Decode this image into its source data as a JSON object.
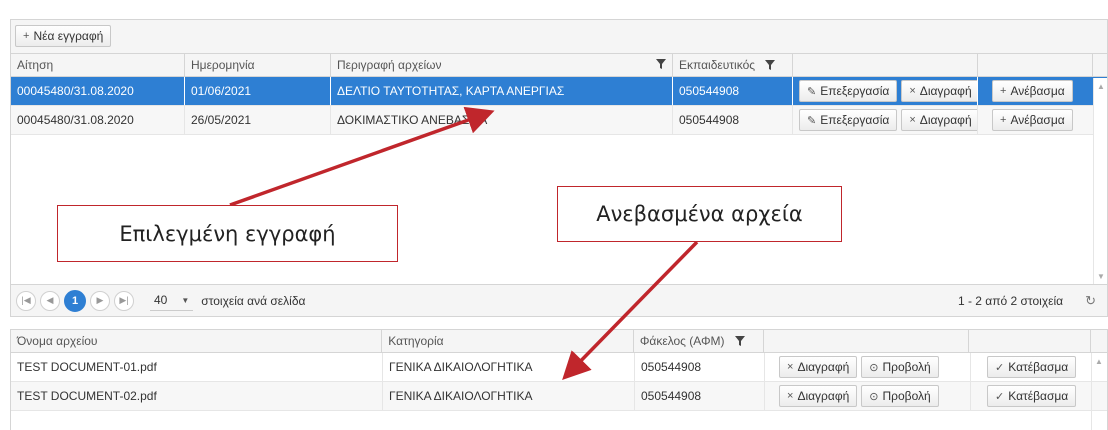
{
  "toolbar": {
    "new_record_label": "Νέα εγγραφή"
  },
  "top_grid": {
    "columns": [
      "Αίτηση",
      "Ημερομηνία",
      "Περιγραφή αρχείων",
      "Εκπαιδευτικός"
    ],
    "rows": [
      {
        "application": "00045480/31.08.2020",
        "date": "01/06/2021",
        "description": "ΔΕΛΤΙΟ ΤΑΥΤΟΤΗΤΑΣ, ΚΑΡΤΑ ΑΝΕΡΓΙΑΣ",
        "teacher": "050544908",
        "selected": true
      },
      {
        "application": "00045480/31.08.2020",
        "date": "26/05/2021",
        "description": "ΔΟΚΙΜΑΣΤΙΚΟ ΑΝΕΒΑΣΜΑ",
        "teacher": "050544908",
        "selected": false
      }
    ],
    "actions": {
      "edit": "Επεξεργασία",
      "delete": "Διαγραφή",
      "upload": "Ανέβασμα"
    }
  },
  "pager": {
    "current_page": "1",
    "page_size": "40",
    "page_size_label": "στοιχεία ανά σελίδα",
    "info": "1 - 2 από 2 στοιχεία"
  },
  "bottom_grid": {
    "columns": [
      "Όνομα αρχείου",
      "Κατηγορία",
      "Φάκελος (ΑΦΜ)"
    ],
    "rows": [
      {
        "file_name": "TEST DOCUMENT-01.pdf",
        "category": "ΓΕΝΙΚΑ ΔΙΚΑΙΟΛΟΓΗΤΙΚΑ",
        "folder": "050544908"
      },
      {
        "file_name": "TEST DOCUMENT-02.pdf",
        "category": "ΓΕΝΙΚΑ ΔΙΚΑΙΟΛΟΓΗΤΙΚΑ",
        "folder": "050544908"
      }
    ],
    "actions": {
      "delete": "Διαγραφή",
      "view": "Προβολή",
      "download": "Κατέβασμα"
    }
  },
  "annotations": {
    "selected_record": "Επιλεγμένη εγγραφή",
    "uploaded_files": "Ανεβασμένα αρχεία",
    "arrow_color": "#c0262c"
  },
  "colors": {
    "selection": "#2e7fd3",
    "annotation_border": "#c0262c"
  }
}
